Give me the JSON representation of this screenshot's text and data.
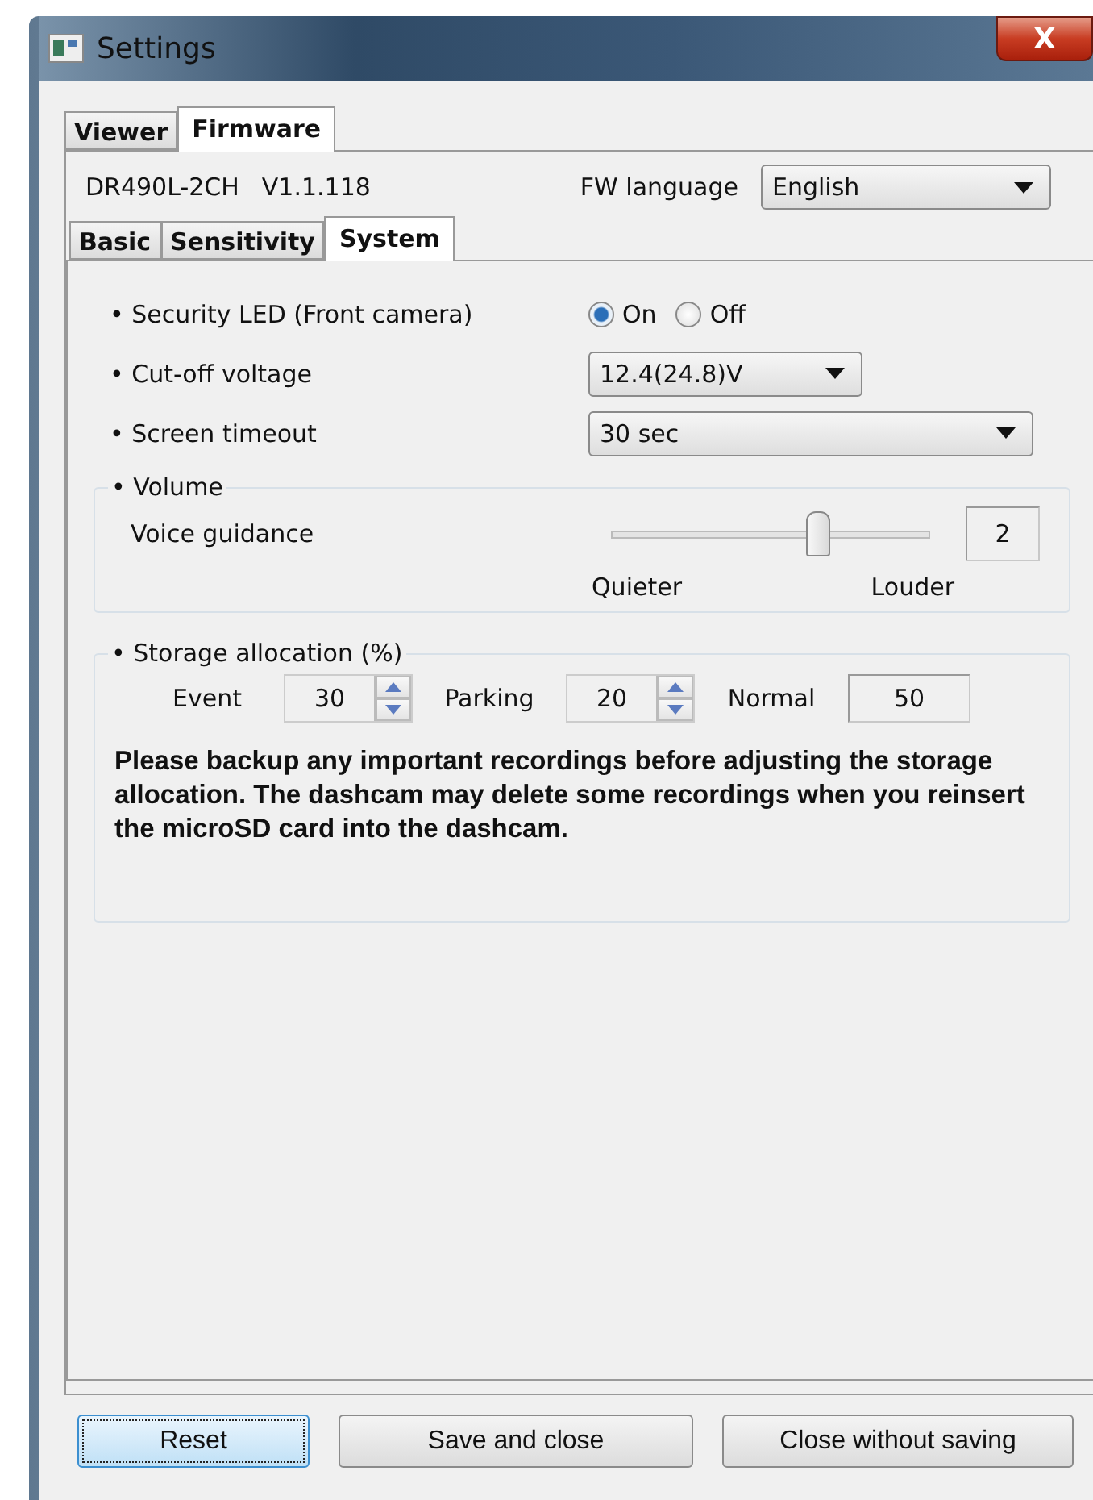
{
  "window": {
    "title": "Settings",
    "close": "X"
  },
  "tabs": [
    {
      "label": "Viewer",
      "selected": false
    },
    {
      "label": "Firmware",
      "selected": true
    }
  ],
  "device": {
    "model": "DR490L-2CH",
    "version": "V1.1.118",
    "language_label": "FW language",
    "language": "English"
  },
  "subtabs": [
    {
      "label": "Basic",
      "selected": false
    },
    {
      "label": "Sensitivity",
      "selected": false
    },
    {
      "label": "System",
      "selected": true
    }
  ],
  "security_led": {
    "label": "• Security LED (Front camera)",
    "options": [
      {
        "label": "On",
        "selected": true
      },
      {
        "label": "Off",
        "selected": false
      }
    ]
  },
  "cutoff": {
    "label": "• Cut-off voltage",
    "value": "12.4(24.8)V"
  },
  "timeout": {
    "label": "• Screen timeout",
    "value": "30 sec"
  },
  "volume": {
    "title": "• Volume",
    "label": "Voice guidance",
    "level": 0.65,
    "value": "2",
    "min_label": "Quieter",
    "max_label": "Louder"
  },
  "storage": {
    "title": "• Storage allocation (%)",
    "fields": [
      {
        "label": "Event",
        "value": "30",
        "kind": "spin"
      },
      {
        "label": "Parking",
        "value": "20",
        "kind": "spin"
      },
      {
        "label": "Normal",
        "value": "50",
        "kind": "readonly"
      }
    ],
    "warning": "Please backup any important recordings before adjusting the storage allocation. The dashcam may delete some recordings when you reinsert the microSD card into the dashcam."
  },
  "buttons": [
    {
      "label": "Reset",
      "selected": true
    },
    {
      "label": "Save and close",
      "selected": false
    },
    {
      "label": "Close without saving",
      "selected": false
    }
  ]
}
